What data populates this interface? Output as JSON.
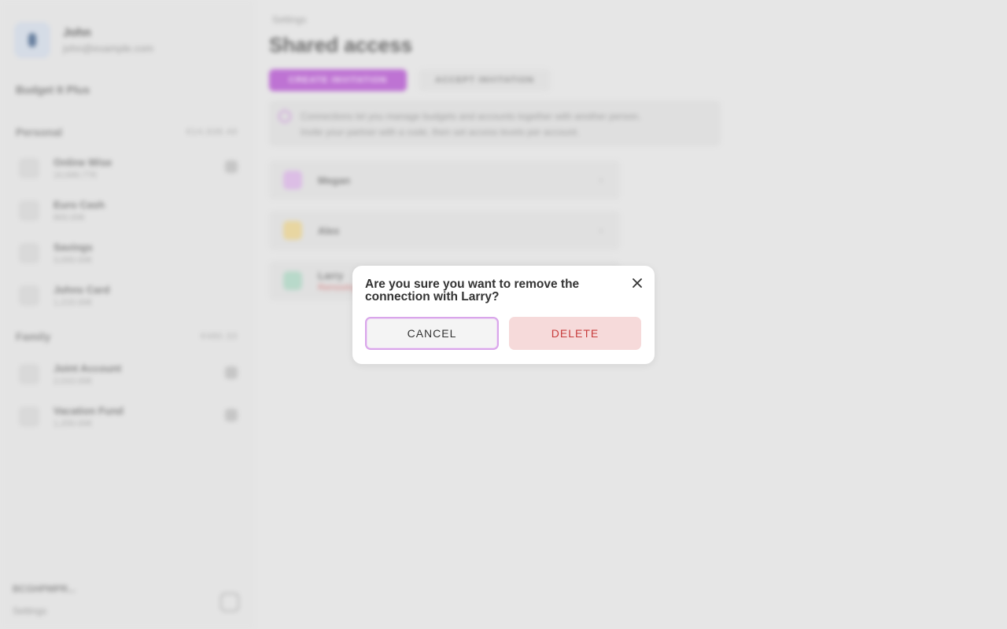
{
  "sidebar": {
    "profile": {
      "name": "John",
      "email": "john@example.com"
    },
    "plan_label": "Budget It Plus",
    "groups": [
      {
        "title": "Personal",
        "amount": "€14,938.49",
        "accounts": [
          {
            "name": "Online Wise",
            "balance": "10,690.77€"
          },
          {
            "name": "Euro Cash",
            "balance": "800.00€"
          },
          {
            "name": "Savings",
            "balance": "3,000.00€"
          },
          {
            "name": "Johns Card",
            "balance": "1,215.00€"
          }
        ]
      },
      {
        "title": "Family",
        "amount": "€480.33",
        "accounts": [
          {
            "name": "Joint Account",
            "balance": "2,010.00€"
          },
          {
            "name": "Vacation Fund",
            "balance": "1,200.00€"
          }
        ]
      }
    ],
    "footer": {
      "code": "BCGHPMPR...",
      "settings_label": "Settings"
    }
  },
  "main": {
    "breadcrumb": "Settings",
    "title": "Shared access",
    "tabs": [
      {
        "label": "CREATE INVITATION"
      },
      {
        "label": "ACCEPT INVITATION"
      }
    ],
    "info": {
      "line1": "Connections let you manage budgets and accounts together with another person.",
      "line2": "Invite your partner with a code, then set access levels per account."
    },
    "connections": [
      {
        "name": "Megan",
        "status": "",
        "color": "#d8b0e4"
      },
      {
        "name": "Alex",
        "status": "",
        "color": "#e8d08a"
      },
      {
        "name": "Larry",
        "status": "Removing...",
        "color": "#a9d4c0"
      }
    ]
  },
  "dialog": {
    "title": "Are you sure you want to remove the connection with Larry?",
    "cancel_label": "CANCEL",
    "delete_label": "DELETE"
  },
  "colors": {
    "accent": "#b04ccc",
    "danger_text": "#c73d3d",
    "danger_bg": "#f6dada"
  }
}
